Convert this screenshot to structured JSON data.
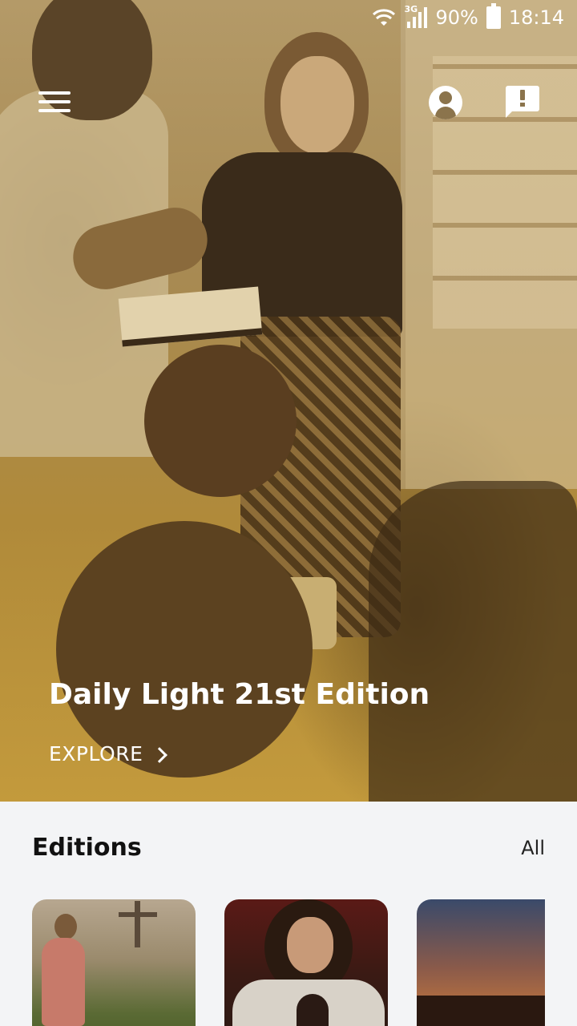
{
  "status_bar": {
    "network": "3G",
    "battery": "90%",
    "time": "18:14"
  },
  "top_bar": {
    "menu_icon": "hamburger-menu-icon",
    "profile_icon": "account-circle-icon",
    "feedback_icon": "feedback-icon"
  },
  "hero": {
    "title": "Daily Light 21st Edition",
    "cta_label": "EXPLORE",
    "cta_icon": "chevron-right-icon",
    "tint_color": "#b8953e"
  },
  "editions": {
    "title": "Editions",
    "all_label": "All",
    "cards": [
      {
        "image": "man-walking-toward-cross"
      },
      {
        "image": "woman-praying-with-bible"
      },
      {
        "image": "hands-raised-at-sunset"
      }
    ]
  }
}
